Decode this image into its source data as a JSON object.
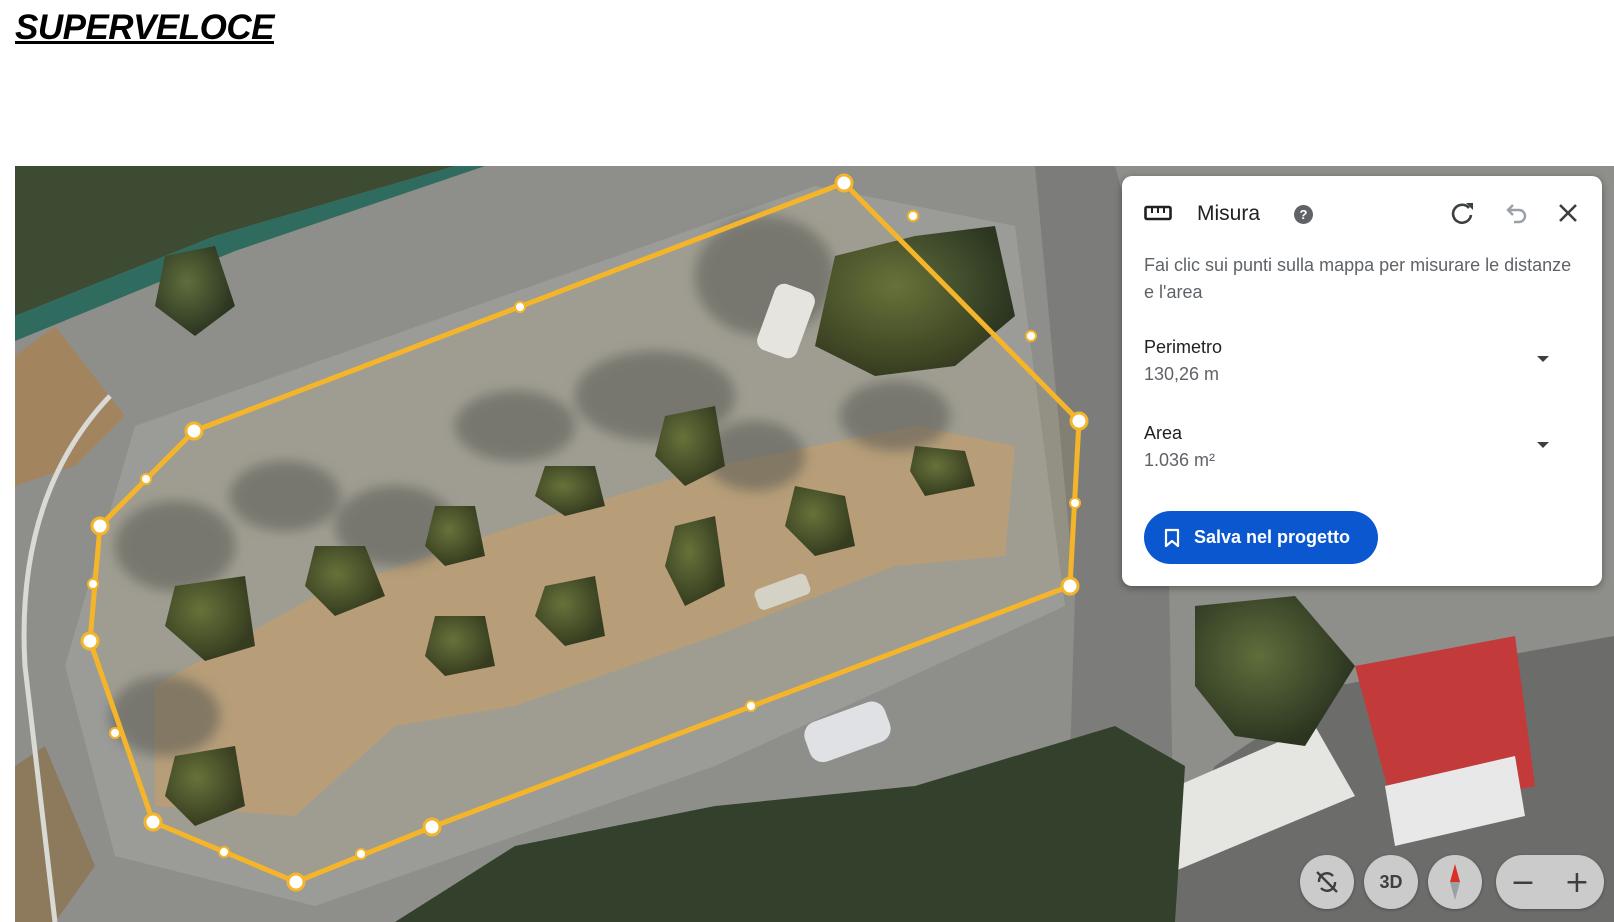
{
  "document": {
    "title": "SUPERVELOCE"
  },
  "measure_panel": {
    "title": "Misura",
    "help_icon": "question-circle-icon",
    "instruction": "Fai clic sui punti sulla mappa per misurare le distanze e l'area",
    "perimeter": {
      "label": "Perimetro",
      "value": "130,26 m"
    },
    "area": {
      "label": "Area",
      "value": "1.036 m²"
    },
    "save_button": {
      "label": "Salva nel progetto",
      "icon": "bookmark-icon"
    },
    "actions": [
      "refresh-icon",
      "undo-icon",
      "close-icon"
    ]
  },
  "map_controls": {
    "tilt_toggle_icon": "rotate-off-icon",
    "view_3d_label": "3D",
    "compass_icon": "compass-icon",
    "zoom_out": "−",
    "zoom_in": "+"
  },
  "colors": {
    "measure_line": "#f5b52a",
    "primary_button": "#0b57d0",
    "compass_north": "#d93025"
  }
}
